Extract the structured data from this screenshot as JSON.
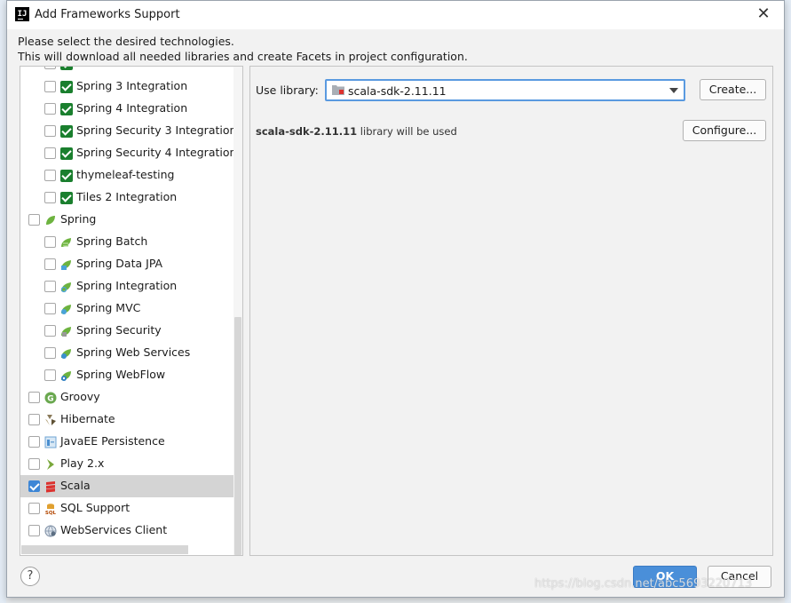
{
  "window": {
    "title": "Add Frameworks Support",
    "app_icon_text": "IJ"
  },
  "intro": {
    "line1": "Please select the desired technologies.",
    "line2": "This will download all needed libraries and create Facets in project configuration."
  },
  "tree": {
    "items": [
      {
        "label": "Spring 3 Integration",
        "level": 1,
        "checked": false,
        "icon": "green-check-icon"
      },
      {
        "label": "Spring 4 Integration",
        "level": 1,
        "checked": false,
        "icon": "green-check-icon"
      },
      {
        "label": "Spring Security 3 Integration",
        "level": 1,
        "checked": false,
        "icon": "green-check-icon"
      },
      {
        "label": "Spring Security 4 Integration",
        "level": 1,
        "checked": false,
        "icon": "green-check-icon"
      },
      {
        "label": "thymeleaf-testing",
        "level": 1,
        "checked": false,
        "icon": "green-check-icon"
      },
      {
        "label": "Tiles 2 Integration",
        "level": 1,
        "checked": false,
        "icon": "green-check-icon"
      },
      {
        "label": "Spring",
        "level": 0,
        "checked": false,
        "icon": "spring-leaf-icon"
      },
      {
        "label": "Spring Batch",
        "level": 1,
        "checked": false,
        "icon": "spring-batch-icon"
      },
      {
        "label": "Spring Data JPA",
        "level": 1,
        "checked": false,
        "icon": "spring-data-icon"
      },
      {
        "label": "Spring Integration",
        "level": 1,
        "checked": false,
        "icon": "spring-integration-icon"
      },
      {
        "label": "Spring MVC",
        "level": 1,
        "checked": false,
        "icon": "spring-mvc-icon"
      },
      {
        "label": "Spring Security",
        "level": 1,
        "checked": false,
        "icon": "spring-security-icon"
      },
      {
        "label": "Spring Web Services",
        "level": 1,
        "checked": false,
        "icon": "spring-ws-icon"
      },
      {
        "label": "Spring WebFlow",
        "level": 1,
        "checked": false,
        "icon": "spring-webflow-icon"
      },
      {
        "label": "Groovy",
        "level": 0,
        "checked": false,
        "icon": "groovy-icon"
      },
      {
        "label": "Hibernate",
        "level": 0,
        "checked": false,
        "icon": "hibernate-icon"
      },
      {
        "label": "JavaEE Persistence",
        "level": 0,
        "checked": false,
        "icon": "persistence-icon"
      },
      {
        "label": "Play 2.x",
        "level": 0,
        "checked": false,
        "icon": "play-icon"
      },
      {
        "label": "Scala",
        "level": 0,
        "checked": true,
        "icon": "scala-icon",
        "selected": true
      },
      {
        "label": "SQL Support",
        "level": 0,
        "checked": false,
        "icon": "sql-icon"
      },
      {
        "label": "WebServices Client",
        "level": 0,
        "checked": false,
        "icon": "webservices-icon"
      }
    ]
  },
  "config": {
    "use_library_label": "Use library:",
    "library_value": "scala-sdk-2.11.11",
    "create_button": "Create...",
    "configure_button": "Configure...",
    "info_library": "scala-sdk-2.11.11",
    "info_suffix": " library will be used"
  },
  "footer": {
    "help": "?",
    "ok": "OK",
    "cancel": "Cancel"
  },
  "watermark": "https://blog.csdn.net/abc5693220713"
}
